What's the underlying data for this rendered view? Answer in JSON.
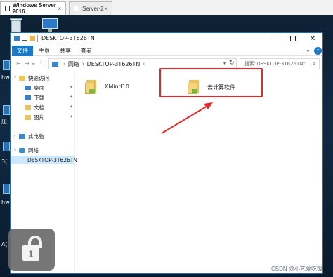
{
  "vm_tabs": [
    {
      "label": "Windows Server 2016",
      "close": "×"
    },
    {
      "label": "Server-2",
      "close": "×"
    }
  ],
  "desktop": {
    "side_labels": [
      "hwi",
      "压",
      "3(",
      "hwi",
      "A("
    ]
  },
  "window": {
    "title": "DESKTOP-3T626TN",
    "controls": {
      "minimize": "—",
      "close": "✕"
    },
    "ribbon": {
      "tabs": [
        "文件",
        "主页",
        "共享",
        "查看"
      ],
      "expand": "⌄",
      "help": "?"
    },
    "address": {
      "back": "←",
      "forward": "→",
      "recent": "▾",
      "up": "↑",
      "segments": [
        "网络",
        "DESKTOP-3T626TN"
      ],
      "separator": "›",
      "dropdown": "▾",
      "refresh": "↻"
    },
    "search": {
      "placeholder": "搜索\"DESKTOP-3T626TN\"",
      "icon": "⌕"
    },
    "nav_pane": {
      "quick_access": "快速访问",
      "items": [
        "桌面",
        "下载",
        "文档",
        "图片"
      ],
      "this_pc": "此电脑",
      "network": "网络",
      "network_child": "DESKTOP-3T626TN",
      "expand_glyph": "›",
      "expanded_glyph": "⌄",
      "pin_glyph": "✦"
    },
    "content": {
      "items": [
        {
          "name": "XMind10",
          "icon": "shared-folder-icon"
        },
        {
          "name": "云计算软件",
          "icon": "shared-folder-icon"
        }
      ]
    }
  },
  "lock_badge": {
    "number": "1"
  },
  "watermark": "CSDN @小艺爱吃饭",
  "colors": {
    "ribbon_file_tab": "#1979ca",
    "highlight": "#e22a2a",
    "selected": "#cce8ff"
  }
}
